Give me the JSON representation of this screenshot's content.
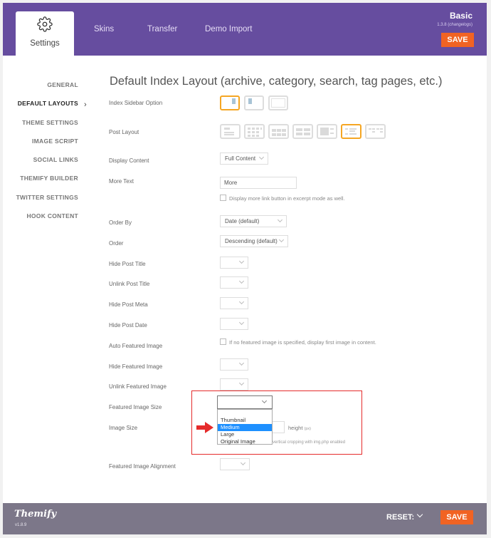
{
  "header": {
    "tabs": [
      {
        "label": "Settings",
        "icon": "gear-icon",
        "active": true
      },
      {
        "label": "Skins"
      },
      {
        "label": "Transfer"
      },
      {
        "label": "Demo Import"
      }
    ],
    "theme_name": "Basic",
    "theme_version": "1.3.8",
    "changelogs_label": "changelogs",
    "save_label": "SAVE",
    "accent": "#664d9f",
    "save_color": "#f16323"
  },
  "sidebar": {
    "items": [
      {
        "label": "GENERAL"
      },
      {
        "label": "DEFAULT LAYOUTS",
        "active": true
      },
      {
        "label": "THEME SETTINGS"
      },
      {
        "label": "IMAGE SCRIPT"
      },
      {
        "label": "SOCIAL LINKS"
      },
      {
        "label": "THEMIFY BUILDER"
      },
      {
        "label": "TWITTER SETTINGS"
      },
      {
        "label": "HOOK CONTENT"
      }
    ],
    "active_chevron": "›"
  },
  "main": {
    "title": "Default Index Layout (archive, category, search, tag pages, etc.)",
    "index_sidebar": {
      "label": "Index Sidebar Option",
      "options": [
        "sidebar-right",
        "sidebar-left",
        "no-sidebar"
      ],
      "selected": "sidebar-right"
    },
    "post_layout": {
      "label": "Post Layout",
      "options": [
        "list-post",
        "grid4",
        "grid3",
        "grid2",
        "grid2-thumb",
        "list-thumb-image",
        "grid2-thumb-alt"
      ],
      "selected": "list-thumb-image"
    },
    "display_content": {
      "label": "Display Content",
      "value": "Full Content"
    },
    "more_text": {
      "label": "More Text",
      "value": "More",
      "checkbox_label": "Display more link button in excerpt mode as well."
    },
    "order_by": {
      "label": "Order By",
      "value": "Date (default)"
    },
    "order": {
      "label": "Order",
      "value": "Descending (default)"
    },
    "hide_post_title": {
      "label": "Hide Post Title",
      "value": ""
    },
    "unlink_post_title": {
      "label": "Unlink Post Title",
      "value": ""
    },
    "hide_post_meta": {
      "label": "Hide Post Meta",
      "value": ""
    },
    "hide_post_date": {
      "label": "Hide Post Date",
      "value": ""
    },
    "auto_featured_image": {
      "label": "Auto Featured Image",
      "checkbox_label": "If no featured image is specified, display first image in content."
    },
    "hide_featured_image": {
      "label": "Hide Featured Image",
      "value": ""
    },
    "unlink_featured_image": {
      "label": "Unlink Featured Image",
      "value": ""
    },
    "featured_image_size": {
      "label": "Featured Image Size",
      "value": "",
      "options": [
        "",
        "Thumbnail",
        "Medium",
        "Large",
        "Original Image"
      ],
      "highlighted": "Medium"
    },
    "image_size": {
      "label": "Image Size",
      "height_label": "height",
      "unit": "(px)",
      "note": "vertical cropping with img.php enabled"
    },
    "featured_image_alignment": {
      "label": "Featured Image Alignment",
      "value": ""
    }
  },
  "footer": {
    "logo": "Themify",
    "version": "v1.8.9",
    "reset_label": "RESET:",
    "save_label": "SAVE"
  }
}
